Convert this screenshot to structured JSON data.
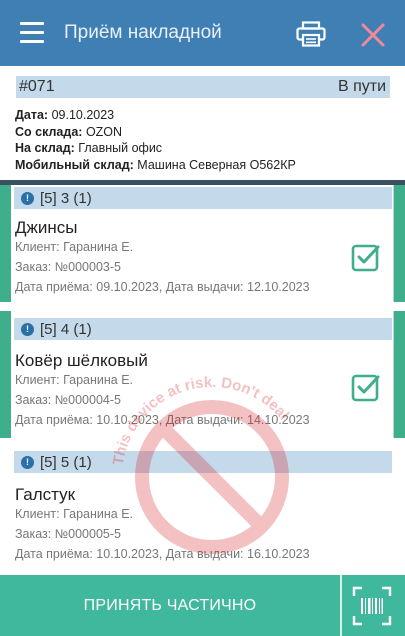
{
  "appbar": {
    "title": "Приём накладной",
    "icons": [
      "menu-icon",
      "printer-icon",
      "close-icon"
    ]
  },
  "document": {
    "number": "#071",
    "status": "В пути",
    "fields": [
      {
        "label": "Дата:",
        "value": "09.10.2023"
      },
      {
        "label": "Со склада:",
        "value": "OZON"
      },
      {
        "label": "На склад:",
        "value": "Главный офис"
      },
      {
        "label": "Мобильный склад:",
        "value": "Машина Северная О562КР"
      }
    ]
  },
  "items": [
    {
      "header": "[5] 3 (1)",
      "name": "Джинсы",
      "client": "Клиент: Гаранина Е.",
      "order": "Заказ: №000003-5",
      "dates": "Дата приёма: 09.10.2023, Дата выдачи: 12.10.2023",
      "checked": true
    },
    {
      "header": "[5] 4 (1)",
      "name": "Ковёр шёлковый",
      "client": "Клиент: Гаранина Е.",
      "order": "Заказ: №000004-5",
      "dates": "Дата приёма: 10.10.2023, Дата выдачи: 14.10.2023",
      "checked": true
    },
    {
      "header": "[5] 5 (1)",
      "name": "Галстук",
      "client": "Клиент: Гаранина Е.",
      "order": "Заказ: №000005-5",
      "dates": "Дата приёма: 10.10.2023, Дата выдачи: 16.10.2023",
      "checked": false
    }
  ],
  "bottom": {
    "accept_label": "ПРИНЯТЬ ЧАСТИЧНО"
  },
  "watermark": {
    "text": "This device at risk. Don't deal"
  },
  "colors": {
    "appbar": "#3f7fb4",
    "bar": "#c4d9ea",
    "accent": "#3fae8b",
    "bottom": "#3fb89d"
  }
}
